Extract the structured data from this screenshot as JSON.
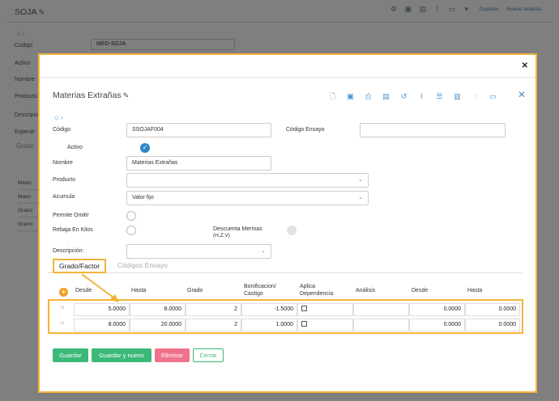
{
  "background": {
    "title": "SOJA",
    "toolbar": {
      "duplicate": "Duplicar",
      "new_analysis": "Nuevo análisis"
    },
    "fields": [
      {
        "label": "Código",
        "value": "MED-SOJA"
      },
      {
        "label": "Activo"
      },
      {
        "label": "Nombre"
      },
      {
        "label": "Producto"
      },
      {
        "label": "Descripción"
      },
      {
        "label": "Especie"
      }
    ],
    "subtab": "Grado",
    "table_rows": [
      "Medic",
      "Mater",
      "Grano",
      "Grano"
    ]
  },
  "modal": {
    "title": "Materias Extrañas",
    "codigo": {
      "label": "Código",
      "value": "SSOJAF004"
    },
    "codigo_ensayo": {
      "label": "Código Ensayo",
      "value": ""
    },
    "activo": {
      "label": "Activo"
    },
    "nombre": {
      "label": "Nombre",
      "value": "Materias Extrañas"
    },
    "producto": {
      "label": "Producto",
      "value": ""
    },
    "acumula": {
      "label": "Acumula",
      "value": "Valor fijo"
    },
    "permite_omitir": {
      "label": "Permite Omitir"
    },
    "rebaja_kilos": {
      "label": "Rebaja En Kilos"
    },
    "descuenta_mermas": {
      "label": "Descuenta Mermas",
      "sublabel": "(H,Z,V)"
    },
    "descripcion": {
      "label": "Descripción:",
      "value": ""
    },
    "tabs": {
      "grado_factor": "Grado/Factor",
      "codigos_ensayo": "Códigos Ensayo"
    },
    "grid": {
      "headers": {
        "desde": "Desde",
        "hasta": "Hasta",
        "grado": "Grado",
        "bonif1": "Bonificacion/",
        "bonif2": "Castigo",
        "aplica1": "Aplica",
        "aplica2": "Dependencia",
        "analisis": "Análisis",
        "desde2": "Desde",
        "hasta2": "Hasta"
      },
      "rows": [
        {
          "desde": "5.0000",
          "hasta": "8.0000",
          "grado": "2",
          "bonif": "-1.5000",
          "desde2": "0.0000",
          "hasta2": "0.0000"
        },
        {
          "desde": "8.0000",
          "hasta": "20.0000",
          "grado": "2",
          "bonif": "1.0000",
          "desde2": "0.0000",
          "hasta2": "0.0000"
        }
      ]
    },
    "buttons": {
      "guardar": "Guardar",
      "guardar_nuevo": "Guardar y nuevo",
      "eliminar": "Eliminar",
      "cerrar": "Cerrar"
    }
  },
  "colors": {
    "accent": "#f3b43b",
    "primary": "#2e86c8",
    "success": "#3cb878",
    "danger": "#f0728a"
  }
}
